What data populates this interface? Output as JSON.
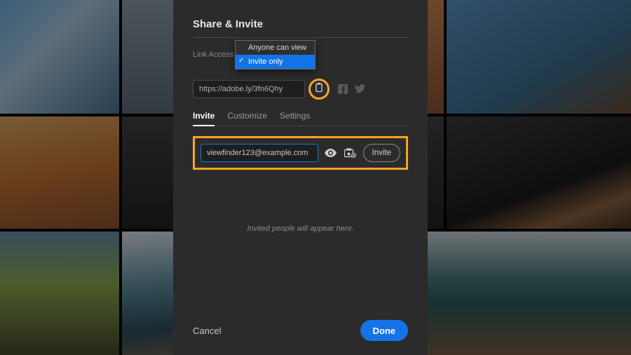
{
  "dialog": {
    "title": "Share & Invite",
    "link_access_label": "Link Access",
    "dropdown": {
      "options": [
        "Anyone can view",
        "Invite only"
      ],
      "selected": "Invite only"
    },
    "url": "https://adobe.ly/3fn6Qhy",
    "copy_icon": "clipboard-icon",
    "share_icons": [
      "facebook-icon",
      "twitter-icon"
    ],
    "tabs": [
      "Invite",
      "Customize",
      "Settings"
    ],
    "active_tab": "Invite",
    "invite": {
      "email_value": "viewfinder123@example.com",
      "permission_icons": [
        "eye-icon",
        "add-contributor-icon"
      ],
      "invite_button": "Invite"
    },
    "empty_state": "Invited people will appear here.",
    "footer": {
      "cancel": "Cancel",
      "done": "Done"
    }
  },
  "highlight_color": "#f5a623",
  "accent_color": "#1473e6"
}
